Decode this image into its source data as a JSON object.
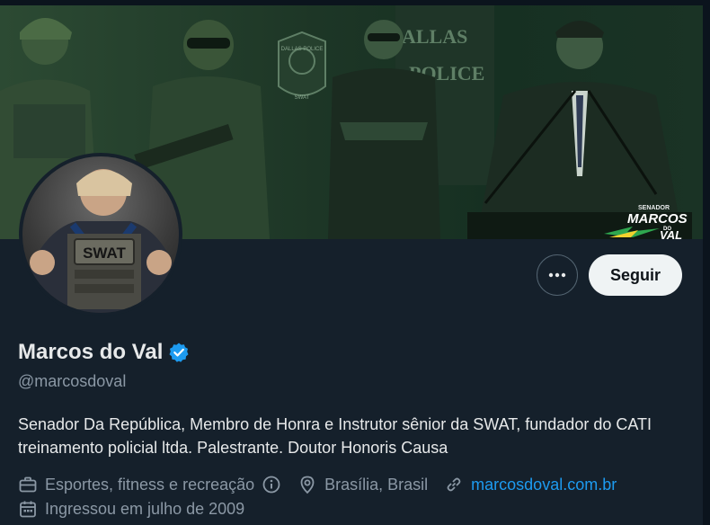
{
  "banner": {
    "logo": {
      "small": "SENADOR",
      "line1": "MARCOS",
      "line2": "DO",
      "line3": "VAL"
    },
    "scene_text": {
      "patch_top": "DALLAS POLICE",
      "patch_bottom": "SWAT",
      "car_line1": "ALLAS",
      "car_line2": "POLICE"
    }
  },
  "avatar": {
    "shirt_text": "SWAT"
  },
  "actions": {
    "more_icon": "ellipsis-icon",
    "follow_label": "Seguir"
  },
  "profile": {
    "name": "Marcos do Val",
    "handle": "@marcosdoval",
    "verified": true,
    "bio": "Senador Da República, Membro de Honra e Instrutor sênior da SWAT, fundador do CATI treinamento policial ltda. Palestrante. Doutor Honoris Causa"
  },
  "meta": {
    "category": "Esportes, fitness e recreação",
    "location": "Brasília, Brasil",
    "link": "marcosdoval.com.br",
    "joined": "Ingressou em julho de 2009"
  },
  "colors": {
    "background": "#15202b",
    "accent": "#1d9bf0",
    "muted": "#8b98a5",
    "text": "#e7e9ea"
  }
}
